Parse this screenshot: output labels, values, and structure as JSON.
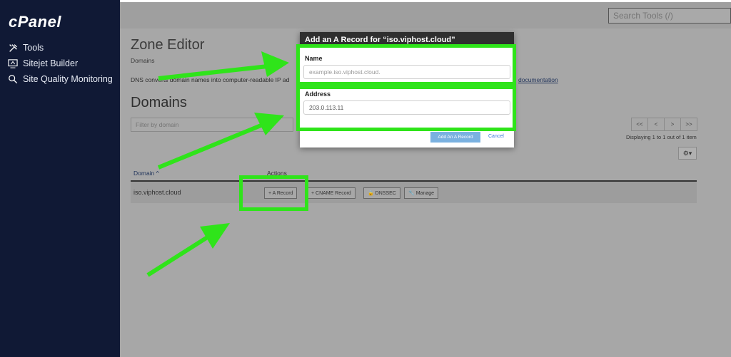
{
  "app": {
    "logo": "cPanel",
    "search_placeholder": "Search Tools (/)"
  },
  "sidebar": {
    "items": [
      {
        "label": "Tools",
        "icon": "tools-icon"
      },
      {
        "label": "Sitejet Builder",
        "icon": "sitejet-icon"
      },
      {
        "label": "Site Quality Monitoring",
        "icon": "magnifier-icon"
      }
    ]
  },
  "page": {
    "title": "Zone Editor",
    "breadcrumb": "Domains",
    "description": "DNS converts domain names into computer-readable IP ad",
    "description_link": "documentation",
    "section_title": "Domains",
    "filter_placeholder": "Filter by domain",
    "pager": [
      "<<",
      "<",
      ">",
      ">>"
    ],
    "displaying": "Displaying 1 to 1 out of 1 item"
  },
  "table": {
    "headers": {
      "domain": "Domain ^",
      "actions": "Actions"
    },
    "rows": [
      {
        "domain": "iso.viphost.cloud",
        "actions": [
          "+ A Record",
          "+ CNAME Record",
          "DNSSEC",
          "Manage"
        ]
      }
    ]
  },
  "modal": {
    "title": "Add an A Record for “iso.viphost.cloud”",
    "name_label": "Name",
    "name_placeholder": "example.iso.viphost.cloud.",
    "address_label": "Address",
    "address_value": "203.0.113.11",
    "submit_label": "Add An A Record",
    "cancel_label": "Cancel"
  },
  "colors": {
    "highlight": "#2fe41a",
    "sidebar": "#101935",
    "primary_button": "#7ab1e0"
  }
}
